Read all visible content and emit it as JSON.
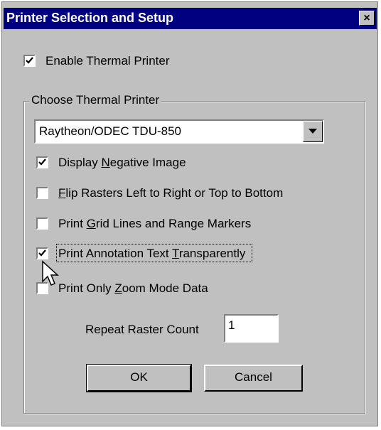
{
  "window": {
    "title": "Printer Selection and Setup",
    "close_label": "×"
  },
  "enable_thermal": {
    "label": "Enable Thermal Printer",
    "checked": true
  },
  "group": {
    "legend": "Choose Thermal Printer",
    "printer_select": {
      "value": "Raytheon/ODEC TDU-850"
    },
    "options": [
      {
        "pre": "Display ",
        "u": "N",
        "post": "egative Image",
        "checked": true
      },
      {
        "pre": "",
        "u": "F",
        "post": "lip Rasters Left to Right or Top to Bottom",
        "checked": false
      },
      {
        "pre": "Print ",
        "u": "G",
        "post": "rid Lines and Range Markers",
        "checked": false
      },
      {
        "pre": "Print Annotation Text ",
        "u": "T",
        "post": "ransparently",
        "checked": true
      },
      {
        "pre": "Print Only ",
        "u": "Z",
        "post": "oom Mode Data",
        "checked": false
      }
    ],
    "repeat_raster": {
      "label": "Repeat Raster Count",
      "value": "1"
    }
  },
  "buttons": {
    "ok": "OK",
    "cancel": "Cancel"
  },
  "icons": {
    "close": "close-icon",
    "dropdown": "dropdown-arrow-icon",
    "check": "check-icon",
    "cursor": "mouse-pointer-icon"
  },
  "colors": {
    "titlebar": "#000080",
    "face": "#c0c0c0"
  }
}
